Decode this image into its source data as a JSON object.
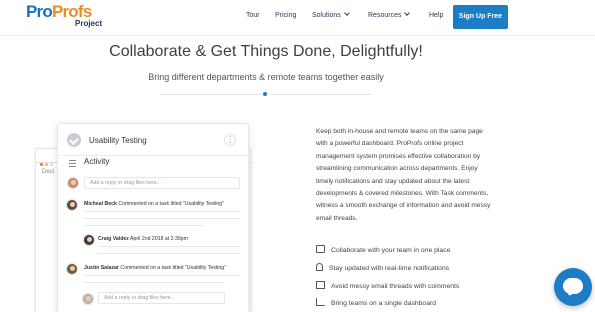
{
  "logo": {
    "pro1": "Pro",
    "pro2": "Profs",
    "sub": "Project"
  },
  "nav": {
    "tour": "Tour",
    "pricing": "Pricing",
    "solutions": "Solutions",
    "resources": "Resources",
    "help": "Help",
    "signup": "Sign Up Free"
  },
  "hero": {
    "title": "Collaborate & Get Things Done, Delightfully!",
    "subtitle": "Bring different departments & remote teams together easily"
  },
  "mock": {
    "back_label": "Desi",
    "task_title": "Usability Testing",
    "activity": "Activity",
    "reply_placeholder_1": "Add a reply or drag files here...",
    "reply_placeholder_2": "Add a reply or drag files here...",
    "comment1_user": "Micheal  Beck",
    "comment1_text": "Commented on a task titled \"Usability Testing\"",
    "comment2_user": "Craig Valdez",
    "comment2_date": "April 2nd 2018 at 2:30pm",
    "comment3_user": "Justin Salazar",
    "comment3_text": "Commented on a task titled \"Usability Testing\""
  },
  "content": {
    "paragraph": "Keep both in-house and remote teams on the same page with a powerful dashboard. ProProfs online project management system promises effective collaboration by streamlining communication across departments. Enjoy timely notifications and stay updated about the latest developments & covered milestones. With Task comments, witness a smooth exchange of information and avoid messy email threads.",
    "features": [
      "Collaborate with your team in one place",
      "Stay updated with real-time notifications",
      "Avoid messy email threads with comments",
      "Bring teams on a single dashboard"
    ]
  },
  "colors": {
    "brand_blue": "#1c7cc4",
    "brand_orange": "#f08a24"
  }
}
